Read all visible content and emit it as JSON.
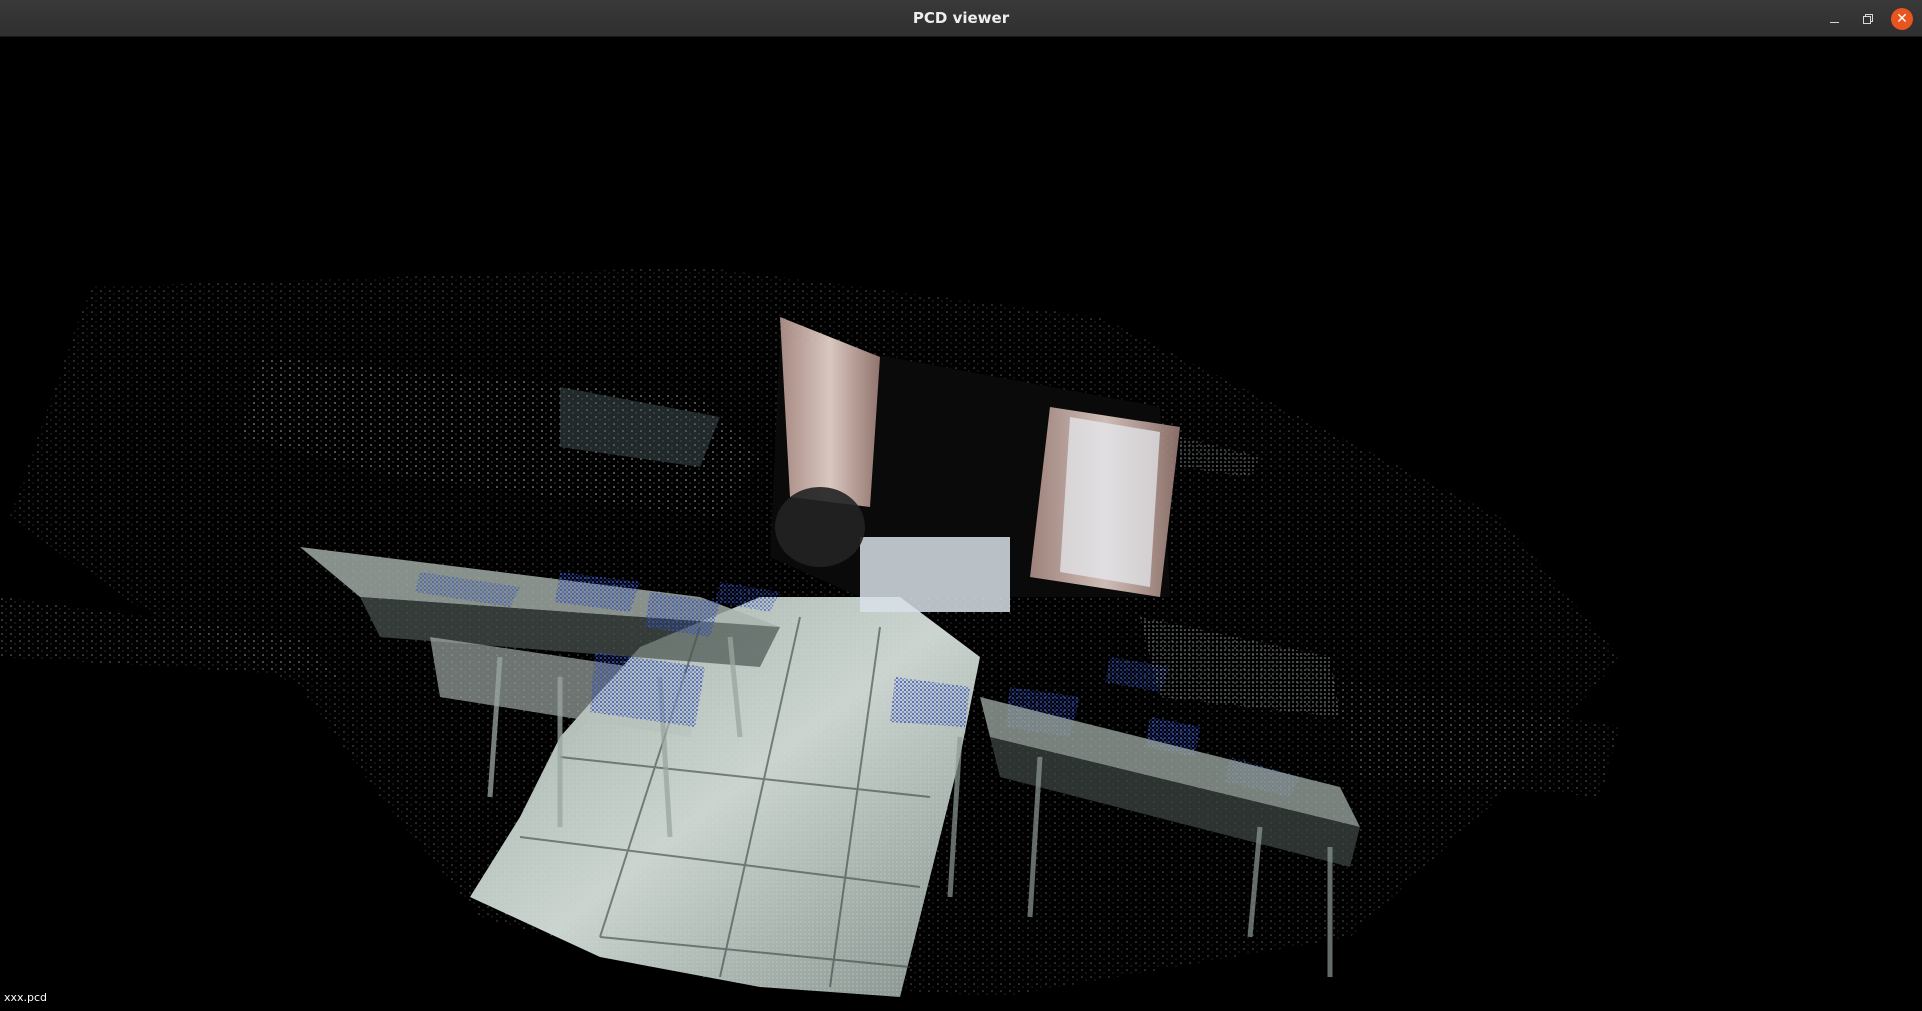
{
  "window": {
    "title": "PCD viewer",
    "controls": {
      "minimize_icon": "minimize-icon",
      "maximize_icon": "restore-icon",
      "close_icon": "close-icon",
      "close_color": "#e95420"
    }
  },
  "viewer": {
    "background_color": "#000000",
    "scene_description_icon": "point-cloud-classroom-scene",
    "status_text": "xxx.pcd"
  },
  "colors": {
    "floor": "#c9d6d0",
    "chair_blue": "#2b4fc4",
    "window_pink": "#d9bfb8",
    "wall_white": "#e6ecf2",
    "titlebar": "#333333"
  }
}
